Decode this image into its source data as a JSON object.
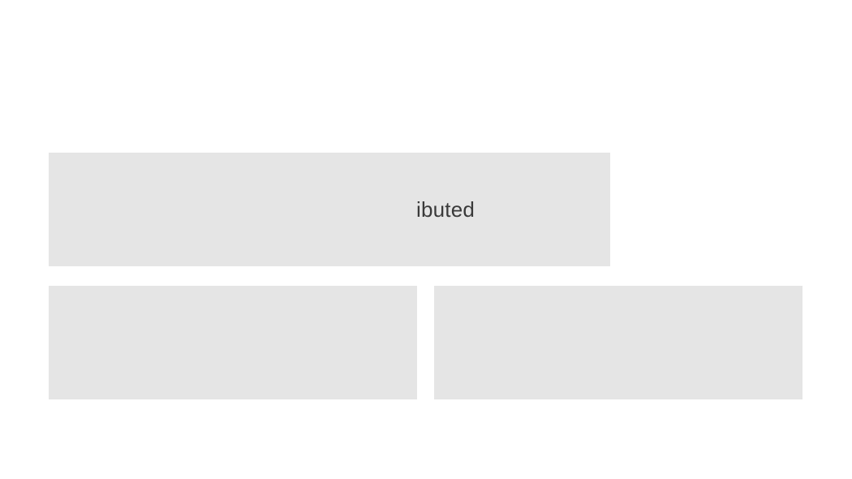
{
  "hero": {
    "text_fragment": "ibuted"
  }
}
